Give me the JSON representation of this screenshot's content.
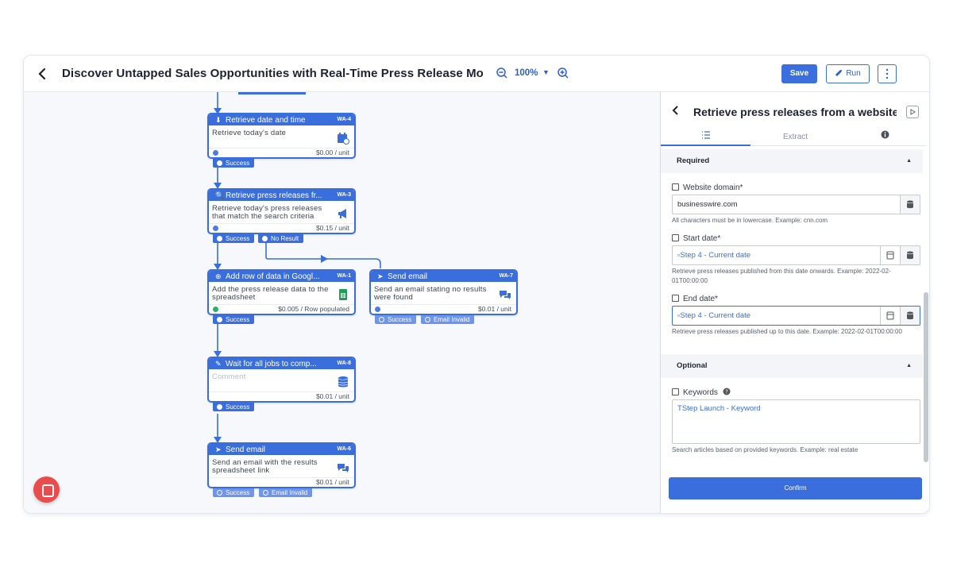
{
  "header": {
    "title": "Discover Untapped Sales Opportunities with Real-Time Press Release Monitoring",
    "zoom": "100%",
    "save_label": "Save",
    "run_label": "Run"
  },
  "workflow": {
    "nodes": [
      {
        "id": "n1",
        "title": "Retrieve date and time",
        "code": "WA-4",
        "description": "Retrieve today's date",
        "price": "$0.00 / unit",
        "icon": "calendar-icon",
        "badges": [
          "Success"
        ]
      },
      {
        "id": "n2",
        "title": "Retrieve press releases fr...",
        "code": "WA-3",
        "description": "Retrieve today's press releases that match the search criteria",
        "price": "$0.15 / unit",
        "icon": "megaphone-icon",
        "badges": [
          "Success",
          "No Result"
        ]
      },
      {
        "id": "n3",
        "title": "Add row of data in Googl...",
        "code": "WA-1",
        "description": "Add the press release data to the spreadsheet",
        "price": "$0.005 / Row populated",
        "icon": "spreadsheet-icon",
        "badges": [
          "Success"
        ]
      },
      {
        "id": "n4",
        "title": "Send email",
        "code": "WA-7",
        "description": "Send an email stating no results were found",
        "price": "$0.01 / unit",
        "icon": "chat-icon",
        "badges": [
          "Success",
          "Email Invalid"
        ]
      },
      {
        "id": "n5",
        "title": "Wait for all jobs to comp...",
        "code": "WA-8",
        "description": "Comment",
        "price": "$0.01 / unit",
        "icon": "database-icon",
        "badges": [
          "Success"
        ]
      },
      {
        "id": "n6",
        "title": "Send email",
        "code": "WA-6",
        "description": "Send an email with the results spreadsheet link",
        "price": "$0.01 / unit",
        "icon": "chat-icon",
        "badges": [
          "Success",
          "Email Invalid"
        ]
      }
    ]
  },
  "panel": {
    "title": "Retrieve press releases from a website",
    "tabs": [
      "",
      "Extract",
      ""
    ],
    "required_label": "Required",
    "optional_label": "Optional",
    "website_label": "Website domain*",
    "website_value": "businesswire.com",
    "website_hint": "All characters must be in lowercase. Example: cnn.com",
    "start_label": "Start date*",
    "start_value": "Step 4 - Current date",
    "start_hint": "Retrieve press releases published from this date onwards. Example: 2022-02-01T00:00:00",
    "end_label": "End date*",
    "end_value": "Step 4 - Current date",
    "end_hint": "Retrieve press releases published up to this date. Example: 2022-02-01T00:00:00",
    "keywords_label": "Keywords",
    "keywords_value": "Step Launch - Keyword",
    "keywords_hint": "Search articles based on provided keywords. Example: real estate",
    "confirm_label": "Confirm"
  },
  "colors": {
    "accent": "#3a6edd",
    "help_bubble": "#e84c4c"
  }
}
